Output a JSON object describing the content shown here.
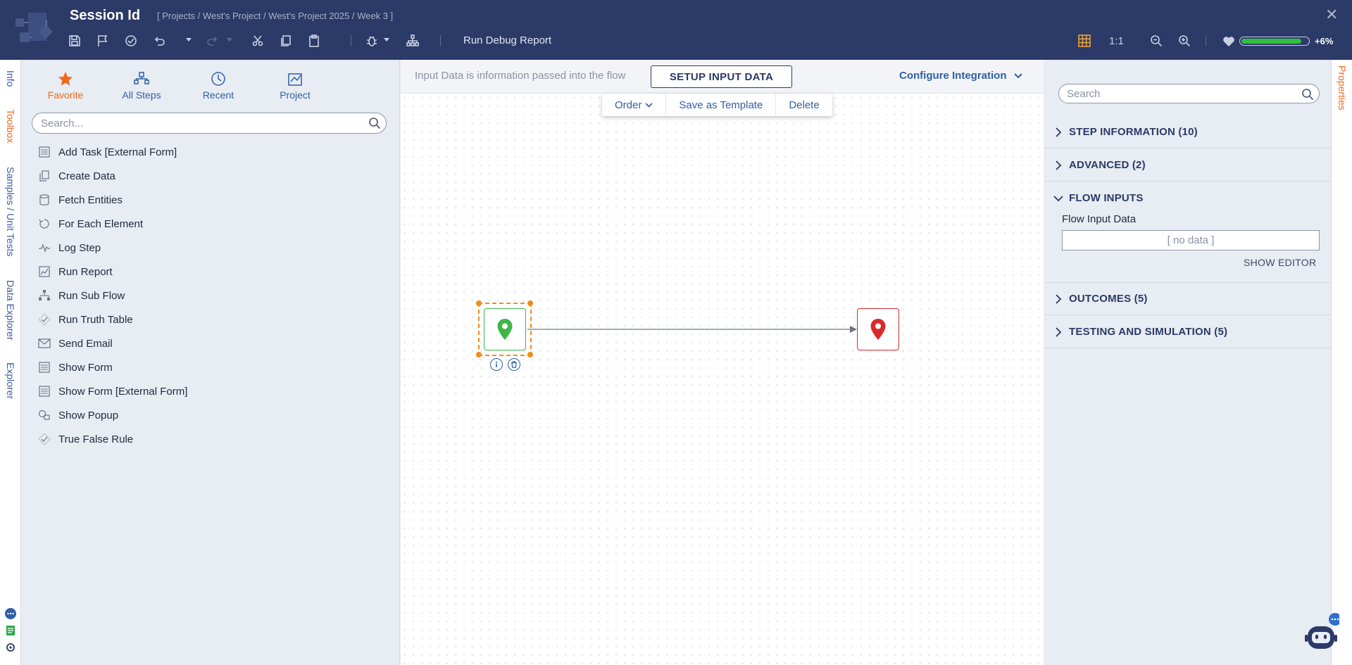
{
  "header": {
    "title": "Session Id",
    "breadcrumb": "[ Projects / West's Project / West's Project 2025 / Week 3 ]",
    "close_label": "✕",
    "run_debug_label": "Run Debug Report",
    "ratio_label": "1:1",
    "health_value": "+6%",
    "health_level": 0.9
  },
  "left_tabs": [
    "Info",
    "Toolbox",
    "Samples / Unit Tests",
    "Data Explorer",
    "Explorer"
  ],
  "toolbox": {
    "tabs": [
      {
        "label": "Favorite",
        "icon": "star-icon"
      },
      {
        "label": "All Steps",
        "icon": "all-steps-icon"
      },
      {
        "label": "Recent",
        "icon": "clock-icon"
      },
      {
        "label": "Project",
        "icon": "project-icon"
      }
    ],
    "search_placeholder": "Search...",
    "items": [
      {
        "label": "Add Task [External Form]",
        "icon": "form-icon"
      },
      {
        "label": "Create Data",
        "icon": "copy-icon"
      },
      {
        "label": "Fetch Entities",
        "icon": "database-icon"
      },
      {
        "label": "For Each Element",
        "icon": "loop-icon"
      },
      {
        "label": "Log Step",
        "icon": "pulse-icon"
      },
      {
        "label": "Run Report",
        "icon": "report-icon"
      },
      {
        "label": "Run Sub Flow",
        "icon": "subflow-icon"
      },
      {
        "label": "Run Truth Table",
        "icon": "diamond-check-icon"
      },
      {
        "label": "Send Email",
        "icon": "envelope-icon"
      },
      {
        "label": "Show Form",
        "icon": "form-icon"
      },
      {
        "label": "Show Form [External Form]",
        "icon": "form-icon"
      },
      {
        "label": "Show Popup",
        "icon": "popup-icon"
      },
      {
        "label": "True False Rule",
        "icon": "diamond-check-icon"
      }
    ]
  },
  "canvas": {
    "info_text": "Input Data is information passed into the flow",
    "setup_button": "SETUP INPUT DATA",
    "configure_integration": "Configure Integration",
    "context_menu": [
      "Order",
      "Save as Template",
      "Delete"
    ]
  },
  "properties": {
    "search_placeholder": "Search",
    "sections": [
      {
        "label": "STEP INFORMATION (10)",
        "open": false
      },
      {
        "label": "ADVANCED (2)",
        "open": false
      },
      {
        "label": "FLOW INPUTS",
        "open": true
      },
      {
        "label": "OUTCOMES (5)",
        "open": false
      },
      {
        "label": "TESTING AND SIMULATION (5)",
        "open": false
      }
    ],
    "flow_input_label": "Flow Input Data",
    "flow_input_value": "[ no data ]",
    "show_editor": "SHOW EDITOR"
  },
  "right_tabs": [
    "Properties"
  ],
  "colors": {
    "header_bg": "#2b3a67",
    "accent_orange": "#f0691b",
    "link_blue": "#2f5fa4",
    "start_green": "#3fb64a",
    "end_red": "#d92a2a"
  }
}
